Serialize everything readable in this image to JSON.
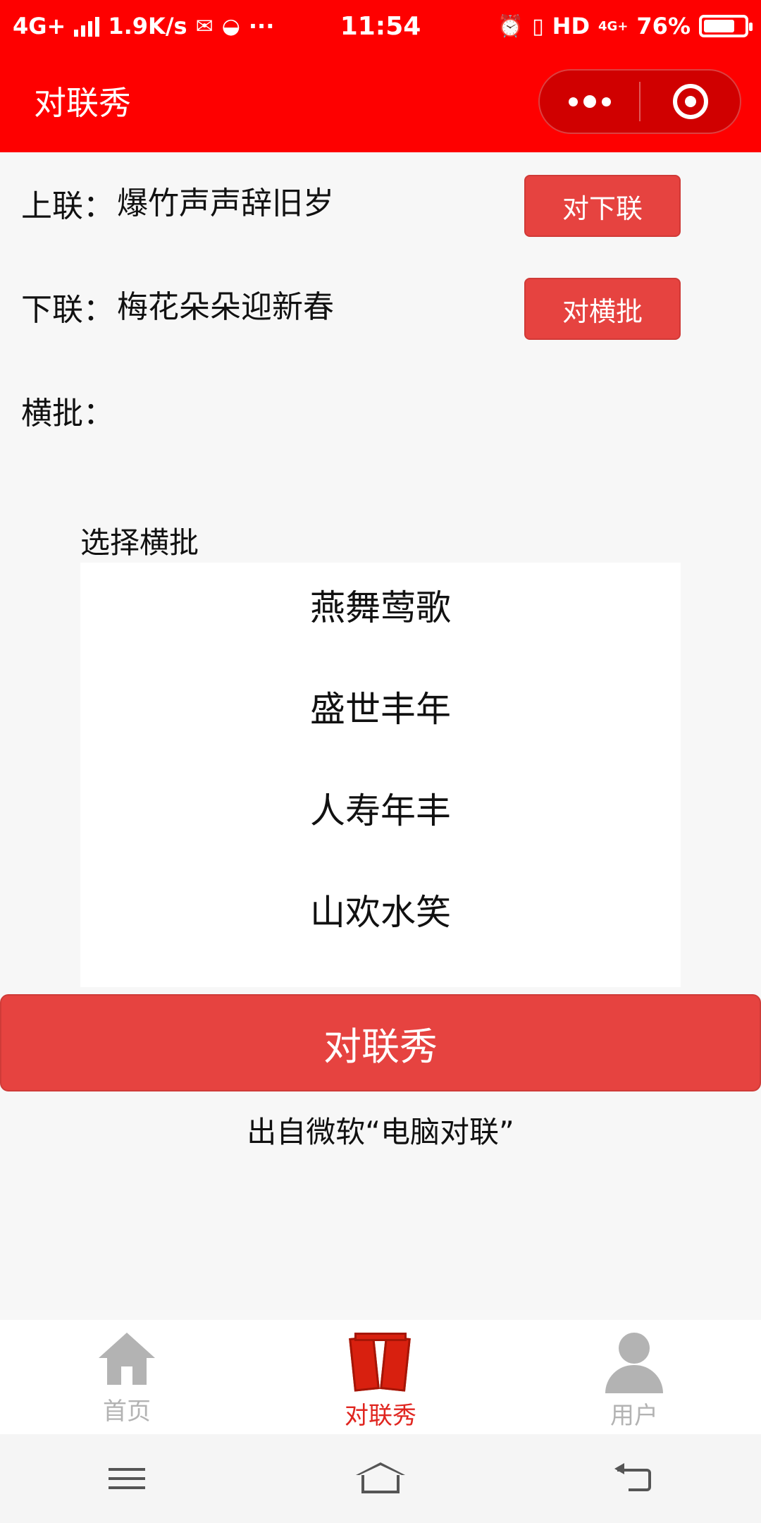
{
  "status_bar": {
    "network": "4G+",
    "speed": "1.9K/s",
    "extra": "···",
    "time": "11:54",
    "hd": "HD",
    "net2": "4G+",
    "battery": "76%",
    "battery_level": 0.76
  },
  "nav": {
    "title": "对联秀"
  },
  "couplet": {
    "upper_label": "上联：",
    "upper_text": "爆竹声声辞旧岁",
    "upper_button": "对下联",
    "lower_label": "下联：",
    "lower_text": "梅花朵朵迎新春",
    "lower_button": "对横批",
    "banner_label": "横批："
  },
  "picker": {
    "title": "选择横批",
    "options": [
      "燕舞莺歌",
      "盛世丰年",
      "人寿年丰",
      "山欢水笑"
    ]
  },
  "main_button": "对联秀",
  "source": "出自微软“电脑对联”",
  "tabs": [
    {
      "label": "首页",
      "icon": "home-icon",
      "active": false
    },
    {
      "label": "对联秀",
      "icon": "couplet-icon",
      "active": true
    },
    {
      "label": "用户",
      "icon": "user-icon",
      "active": false
    }
  ],
  "colors": {
    "brand": "#fe0000",
    "button": "#e64340",
    "active_tab": "#e0251f",
    "inactive_tab": "#b3b3b3"
  }
}
